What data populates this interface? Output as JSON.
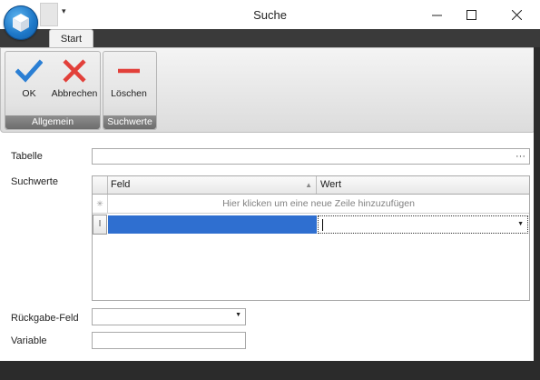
{
  "window": {
    "title": "Suche",
    "controls": {
      "minimize_icon": "minimize-icon",
      "maximize_icon": "maximize-icon",
      "close_icon": "close-icon"
    }
  },
  "qat": {
    "menu_icon": "dropdown-arrow-icon"
  },
  "tabs": [
    {
      "label": "Start",
      "active": true
    }
  ],
  "ribbon": {
    "groups": [
      {
        "label": "Allgemein",
        "buttons": [
          {
            "label": "OK",
            "icon": "checkmark-icon",
            "color": "#2b7fd4"
          },
          {
            "label": "Abbrechen",
            "icon": "cross-icon",
            "color": "#e2403a"
          }
        ]
      },
      {
        "label": "Suchwerte",
        "buttons": [
          {
            "label": "Löschen",
            "icon": "minus-icon",
            "color": "#e2403a"
          }
        ]
      }
    ]
  },
  "form": {
    "tabelle": {
      "label": "Tabelle",
      "value": "",
      "button": "···"
    },
    "suchwerte": {
      "label": "Suchwerte",
      "columns": [
        "Feld",
        "Wert"
      ],
      "new_row_text": "Hier klicken um eine neue Zeile hinzuzufügen",
      "rows": [
        {
          "feld": "",
          "wert": ""
        }
      ]
    },
    "rueckgabe": {
      "label": "Rückgabe-Feld",
      "value": ""
    },
    "variable": {
      "label": "Variable",
      "value": ""
    }
  },
  "colors": {
    "accent": "#2f6fd0",
    "dark_chrome": "#2b2b2b"
  }
}
